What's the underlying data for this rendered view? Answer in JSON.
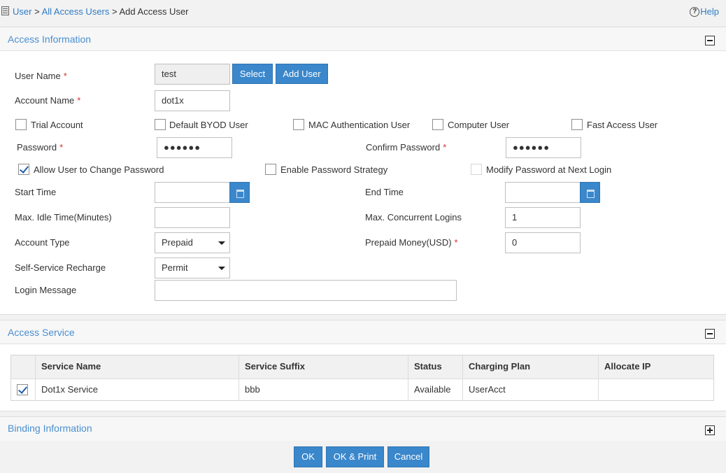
{
  "breadcrumb": {
    "items": [
      "User",
      "All Access Users"
    ],
    "separator": ">",
    "current": "Add Access User"
  },
  "help_label": "Help",
  "access_info": {
    "title": "Access Information",
    "user_name": {
      "label": "User Name",
      "value": "test"
    },
    "select_button": "Select",
    "add_user_button": "Add User",
    "account_name": {
      "label": "Account Name",
      "value": "dot1x"
    },
    "checkboxes": [
      {
        "label": "Trial Account",
        "checked": false
      },
      {
        "label": "Default BYOD User",
        "checked": false
      },
      {
        "label": "MAC Authentication User",
        "checked": false
      },
      {
        "label": "Computer User",
        "checked": false
      },
      {
        "label": "Fast Access User",
        "checked": false
      }
    ],
    "password": {
      "label": "Password",
      "value": "●●●●●●"
    },
    "confirm_password": {
      "label": "Confirm Password",
      "value": "●●●●●●"
    },
    "allow_change_password": {
      "label": "Allow User to Change Password",
      "checked": true
    },
    "enable_password_strategy": {
      "label": "Enable Password Strategy",
      "checked": false
    },
    "modify_password_next_login": {
      "label": "Modify Password at Next Login",
      "checked": false
    },
    "start_time": {
      "label": "Start Time",
      "value": ""
    },
    "end_time": {
      "label": "End Time",
      "value": ""
    },
    "max_idle_time": {
      "label": "Max. Idle Time(Minutes)",
      "value": ""
    },
    "max_concurrent_logins": {
      "label": "Max. Concurrent Logins",
      "value": "1"
    },
    "account_type": {
      "label": "Account Type",
      "value": "Prepaid"
    },
    "prepaid_money": {
      "label": "Prepaid Money(USD)",
      "value": "0"
    },
    "self_service_recharge": {
      "label": "Self-Service Recharge",
      "value": "Permit"
    },
    "login_message": {
      "label": "Login Message",
      "value": ""
    }
  },
  "access_service": {
    "title": "Access Service",
    "columns": [
      "Service Name",
      "Service Suffix",
      "Status",
      "Charging Plan",
      "Allocate IP"
    ],
    "rows": [
      {
        "checked": true,
        "service_name": "Dot1x Service",
        "service_suffix": "bbb",
        "status": "Available",
        "charging_plan": "UserAcct",
        "allocate_ip": ""
      }
    ]
  },
  "binding_info": {
    "title": "Binding Information"
  },
  "footer": {
    "ok": "OK",
    "ok_print": "OK & Print",
    "cancel": "Cancel"
  },
  "colors": {
    "accent": "#3a87cb",
    "link": "#2e7bc4",
    "required": "#d2322d"
  }
}
